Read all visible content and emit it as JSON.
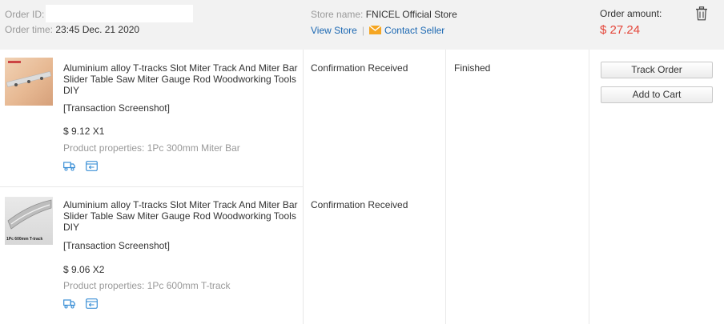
{
  "order": {
    "id_label": "Order ID:",
    "time_label": "Order time:",
    "time_value": "23:45 Dec. 21 2020",
    "store_label": "Store name:",
    "store_name": "FNICEL Official Store",
    "view_store": "View Store",
    "separator": "|",
    "contact_seller": "Contact Seller",
    "amount_label": "Order amount:",
    "amount_value": "$ 27.24"
  },
  "items": [
    {
      "title": "Aluminium alloy T-tracks Slot Miter Track And Miter Bar Slider Table Saw Miter Gauge Rod Woodworking Tools DIY",
      "screenshot_link": "[Transaction Screenshot]",
      "price": "$ 9.12 X1",
      "properties": "Product properties: 1Pc 300mm Miter Bar",
      "status": "Confirmation Received",
      "thumb_caption": ""
    },
    {
      "title": "Aluminium alloy T-tracks Slot Miter Track And Miter Bar Slider Table Saw Miter Gauge Rod Woodworking Tools DIY",
      "screenshot_link": "[Transaction Screenshot]",
      "price": "$ 9.06 X2",
      "properties": "Product properties: 1Pc 600mm T-track",
      "status": "Confirmation Received",
      "thumb_caption": "1Pc 600mm T-track"
    }
  ],
  "order_status": "Finished",
  "actions": {
    "track_order": "Track Order",
    "add_to_cart": "Add to Cart"
  },
  "colors": {
    "link": "#1a67b2",
    "amount": "#e4463a",
    "header_bg": "#f2f2f2"
  }
}
